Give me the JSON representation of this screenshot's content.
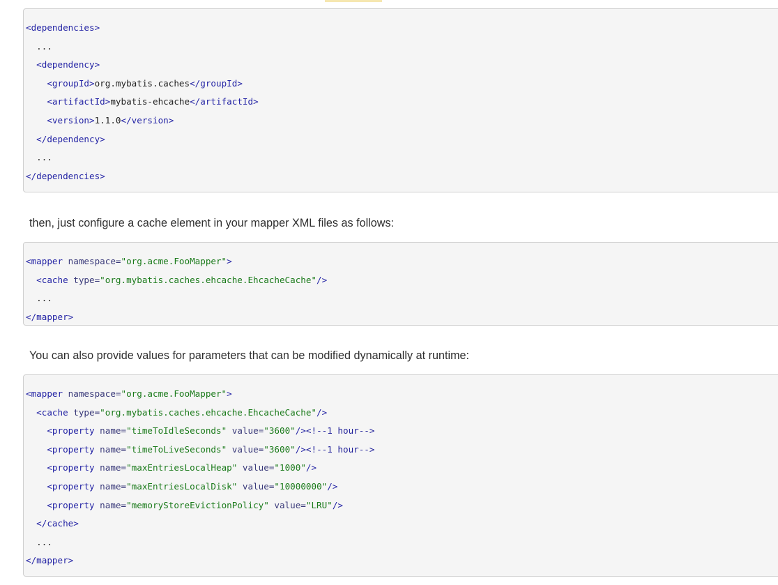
{
  "code_blocks": [
    {
      "lines": [
        [
          [
            "tag",
            "<dependencies>"
          ]
        ],
        [
          [
            "text",
            "  ..."
          ]
        ],
        [
          [
            "text",
            "  "
          ],
          [
            "tag",
            "<dependency>"
          ]
        ],
        [
          [
            "text",
            "    "
          ],
          [
            "tag",
            "<groupId>"
          ],
          [
            "text",
            "org.mybatis.caches"
          ],
          [
            "tag",
            "</groupId>"
          ]
        ],
        [
          [
            "text",
            "    "
          ],
          [
            "tag",
            "<artifactId>"
          ],
          [
            "text",
            "mybatis-ehcache"
          ],
          [
            "tag",
            "</artifactId>"
          ]
        ],
        [
          [
            "text",
            "    "
          ],
          [
            "tag",
            "<version>"
          ],
          [
            "text",
            "1.1.0"
          ],
          [
            "tag",
            "</version>"
          ]
        ],
        [
          [
            "text",
            "  "
          ],
          [
            "tag",
            "</dependency>"
          ]
        ],
        [
          [
            "text",
            "  ..."
          ]
        ],
        [
          [
            "tag",
            "</dependencies>"
          ]
        ]
      ]
    },
    {
      "lines": [
        [
          [
            "tag",
            "<mapper "
          ],
          [
            "attr",
            "namespace="
          ],
          [
            "str",
            "\"org.acme.FooMapper\""
          ],
          [
            "tag",
            ">"
          ]
        ],
        [
          [
            "text",
            "  "
          ],
          [
            "tag",
            "<cache "
          ],
          [
            "attr",
            "type="
          ],
          [
            "str",
            "\"org.mybatis.caches.ehcache.EhcacheCache\""
          ],
          [
            "tag",
            "/>"
          ]
        ],
        [
          [
            "text",
            "  ..."
          ]
        ],
        [
          [
            "tag",
            "</mapper>"
          ]
        ]
      ]
    },
    {
      "lines": [
        [
          [
            "tag",
            "<mapper "
          ],
          [
            "attr",
            "namespace="
          ],
          [
            "str",
            "\"org.acme.FooMapper\""
          ],
          [
            "tag",
            ">"
          ]
        ],
        [
          [
            "text",
            "  "
          ],
          [
            "tag",
            "<cache "
          ],
          [
            "attr",
            "type="
          ],
          [
            "str",
            "\"org.mybatis.caches.ehcache.EhcacheCache\""
          ],
          [
            "tag",
            "/>"
          ]
        ],
        [
          [
            "text",
            "    "
          ],
          [
            "tag",
            "<property "
          ],
          [
            "attr",
            "name="
          ],
          [
            "str",
            "\"timeToIdleSeconds\""
          ],
          [
            "attr",
            " value="
          ],
          [
            "str",
            "\"3600\""
          ],
          [
            "tag",
            "/>"
          ],
          [
            "comment",
            "<!--1 hour-->"
          ]
        ],
        [
          [
            "text",
            "    "
          ],
          [
            "tag",
            "<property "
          ],
          [
            "attr",
            "name="
          ],
          [
            "str",
            "\"timeToLiveSeconds\""
          ],
          [
            "attr",
            " value="
          ],
          [
            "str",
            "\"3600\""
          ],
          [
            "tag",
            "/>"
          ],
          [
            "comment",
            "<!--1 hour-->"
          ]
        ],
        [
          [
            "text",
            "    "
          ],
          [
            "tag",
            "<property "
          ],
          [
            "attr",
            "name="
          ],
          [
            "str",
            "\"maxEntriesLocalHeap\""
          ],
          [
            "attr",
            " value="
          ],
          [
            "str",
            "\"1000\""
          ],
          [
            "tag",
            "/>"
          ]
        ],
        [
          [
            "text",
            "    "
          ],
          [
            "tag",
            "<property "
          ],
          [
            "attr",
            "name="
          ],
          [
            "str",
            "\"maxEntriesLocalDisk\""
          ],
          [
            "attr",
            " value="
          ],
          [
            "str",
            "\"10000000\""
          ],
          [
            "tag",
            "/>"
          ]
        ],
        [
          [
            "text",
            "    "
          ],
          [
            "tag",
            "<property "
          ],
          [
            "attr",
            "name="
          ],
          [
            "str",
            "\"memoryStoreEvictionPolicy\""
          ],
          [
            "attr",
            " value="
          ],
          [
            "str",
            "\"LRU\""
          ],
          [
            "tag",
            "/>"
          ]
        ],
        [
          [
            "text",
            "  "
          ],
          [
            "tag",
            "</cache>"
          ]
        ],
        [
          [
            "text",
            "  ..."
          ]
        ],
        [
          [
            "tag",
            "</mapper>"
          ]
        ]
      ]
    }
  ],
  "prose": {
    "p1": "then, just configure a cache element in your mapper XML files as follows:",
    "p2": "You can also provide values for parameters that can be modified dynamically at runtime:"
  }
}
